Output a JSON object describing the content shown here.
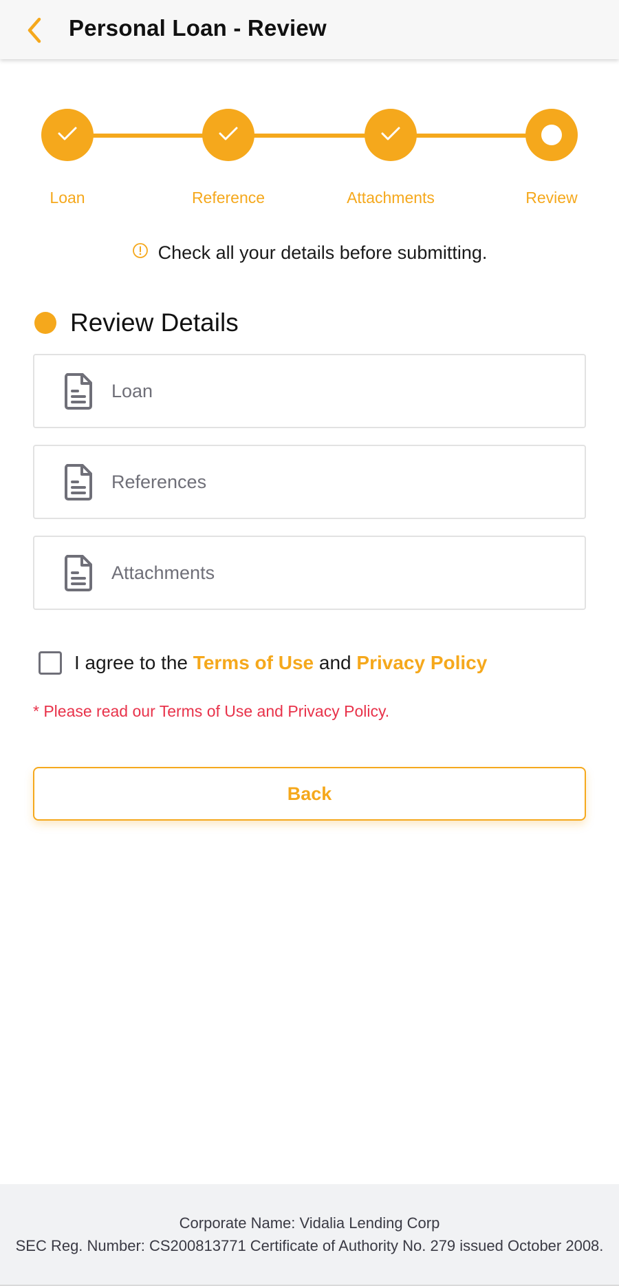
{
  "header": {
    "title": "Personal Loan - Review",
    "back_icon": "chevron-left-icon"
  },
  "colors": {
    "accent": "#F5A81C",
    "warning": "#e8324a",
    "muted": "#6f6f78"
  },
  "stepper": {
    "steps": [
      {
        "label": "Loan",
        "status": "completed"
      },
      {
        "label": "Reference",
        "status": "completed"
      },
      {
        "label": "Attachments",
        "status": "completed"
      },
      {
        "label": "Review",
        "status": "current"
      }
    ]
  },
  "notice": {
    "icon": "info-circle-icon",
    "text": "Check all your details before submitting."
  },
  "review": {
    "title": "Review Details",
    "items": [
      {
        "label": "Loan",
        "icon": "document-icon"
      },
      {
        "label": "References",
        "icon": "document-icon"
      },
      {
        "label": "Attachments",
        "icon": "document-icon"
      }
    ]
  },
  "agreement": {
    "checked": false,
    "prefix": "I agree to the ",
    "terms_link": "Terms of Use",
    "middle": " and ",
    "privacy_link": "Privacy Policy",
    "warning": "* Please read our Terms of Use and Privacy Policy."
  },
  "actions": {
    "back_label": "Back"
  },
  "footer": {
    "line1": "Corporate Name: Vidalia Lending Corp",
    "line2": "SEC Reg. Number: CS200813771 Certificate of Authority No. 279 issued October 2008."
  }
}
